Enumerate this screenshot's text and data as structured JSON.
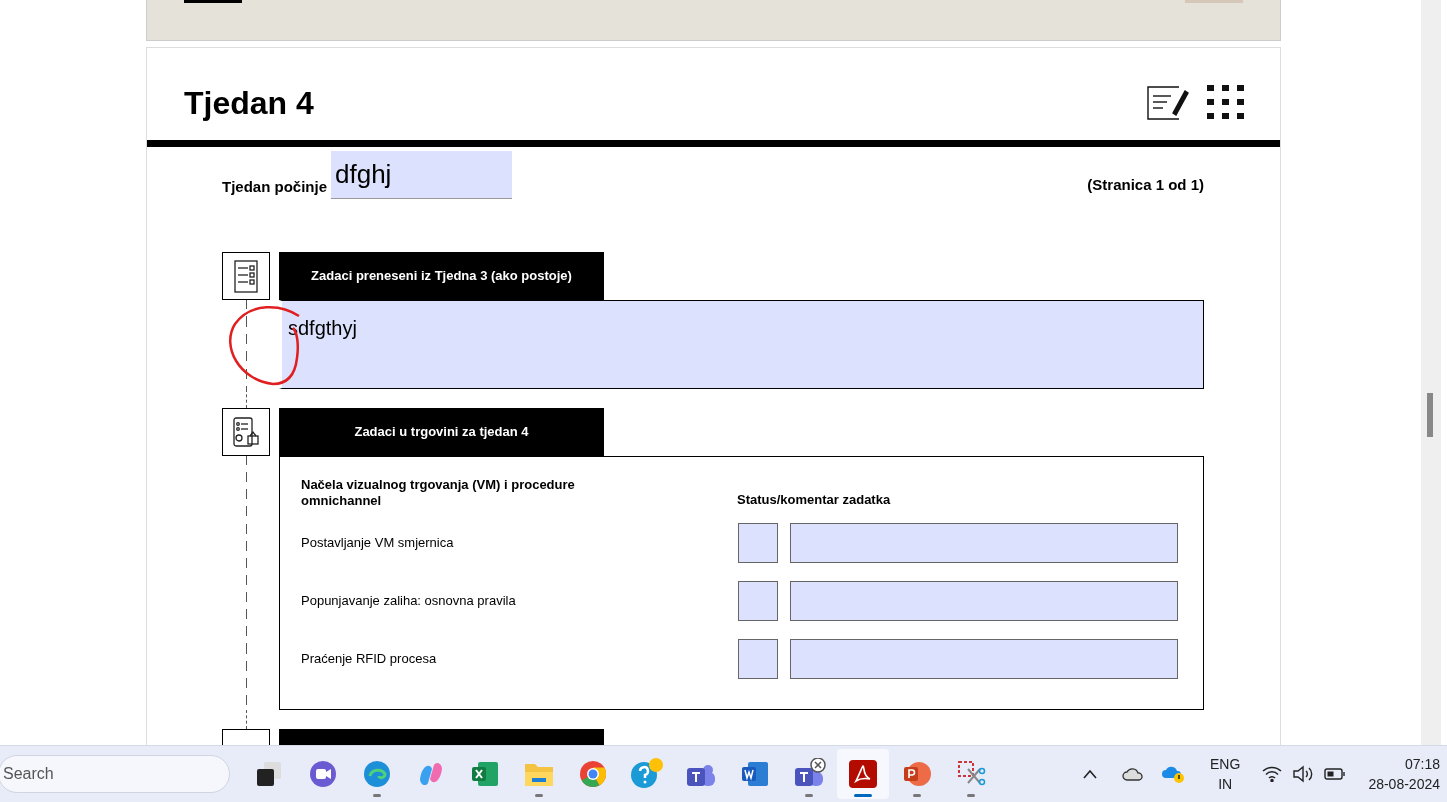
{
  "document": {
    "title": "Tjedan 4",
    "week_start": {
      "label": "Tjedan počinje",
      "value": "dfghj"
    },
    "page_indicator": "(Stranica 1 od 1)",
    "sections": [
      {
        "kind": "text",
        "title": "Zadaci preneseni iz Tjedna 3 (ako postoje)",
        "value": "sdfgthyj"
      },
      {
        "kind": "tasks",
        "title": "Zadaci u trgovini za tjedan 4",
        "heading": "Načela vizualnog trgovanja (VM) i procedure omnichannel",
        "status_heading": "Status/komentar zadatka",
        "tasks": [
          {
            "label": "Postavljanje VM smjernica"
          },
          {
            "label": "Popunjavanje zaliha: osnovna pravila"
          },
          {
            "label": "Praćenje RFID procesa"
          }
        ]
      },
      {
        "kind": "cut"
      }
    ]
  },
  "taskbar": {
    "search": {
      "placeholder": "Search"
    },
    "apps": [
      {
        "kind": "taskview",
        "running": false,
        "active": false
      },
      {
        "kind": "meet",
        "running": false,
        "active": false
      },
      {
        "kind": "edge",
        "running": true,
        "active": false
      },
      {
        "kind": "copilot",
        "running": false,
        "active": false
      },
      {
        "kind": "excel",
        "running": false,
        "active": false
      },
      {
        "kind": "files",
        "running": true,
        "active": false
      },
      {
        "kind": "chrome",
        "running": false,
        "active": false
      },
      {
        "kind": "help",
        "running": false,
        "active": false
      },
      {
        "kind": "teams",
        "running": false,
        "active": false
      },
      {
        "kind": "word",
        "running": false,
        "active": false
      },
      {
        "kind": "teams_alert",
        "running": true,
        "active": false
      },
      {
        "kind": "acrobat",
        "running": true,
        "active": true
      },
      {
        "kind": "powerpoint",
        "running": true,
        "active": false
      },
      {
        "kind": "snip",
        "running": true,
        "active": false
      }
    ],
    "language": [
      "ENG",
      "IN"
    ],
    "time": "07:18",
    "date": "28-08-2024"
  }
}
